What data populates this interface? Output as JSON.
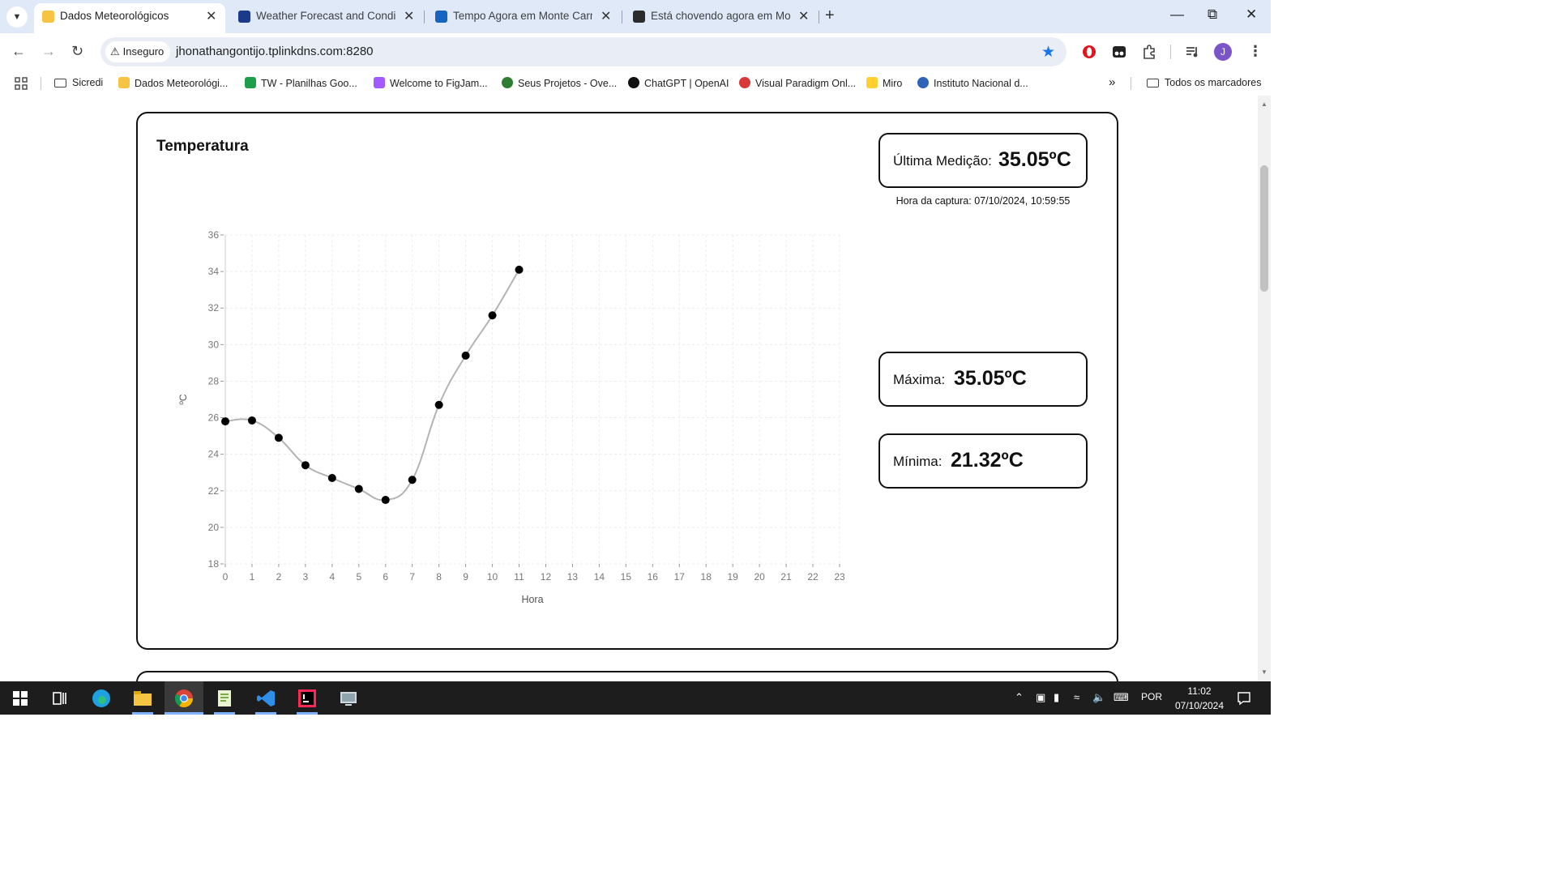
{
  "browser": {
    "tabs": [
      {
        "title": "Dados Meteorológicos",
        "active": true
      },
      {
        "title": "Weather Forecast and Condition",
        "active": false
      },
      {
        "title": "Tempo Agora em Monte Carme",
        "active": false
      },
      {
        "title": "Está chovendo agora em Monte",
        "active": false
      }
    ],
    "security_label": "Inseguro",
    "url": "jhonathangontijo.tplinkdns.com:8280",
    "avatar_letter": "J",
    "bookmarks": [
      {
        "label": "Sicredi"
      },
      {
        "label": "Dados Meteorológi..."
      },
      {
        "label": "TW - Planilhas Goo..."
      },
      {
        "label": "Welcome to FigJam..."
      },
      {
        "label": "Seus Projetos - Ove..."
      },
      {
        "label": "ChatGPT | OpenAI"
      },
      {
        "label": "Visual Paradigm Onl..."
      },
      {
        "label": "Miro"
      },
      {
        "label": "Instituto Nacional d..."
      }
    ],
    "all_bookmarks": "Todos os marcadores"
  },
  "panel": {
    "title": "Temperatura",
    "last": {
      "label": "Última Medição:",
      "value": "35.05ºC"
    },
    "capture_time": "Hora da captura: 07/10/2024, 10:59:55",
    "max": {
      "label": "Máxima:",
      "value": "35.05ºC"
    },
    "min": {
      "label": "Mínima:",
      "value": "21.32ºC"
    }
  },
  "chart_data": {
    "type": "line",
    "xlabel": "Hora",
    "ylabel": "ºC",
    "x": [
      0,
      1,
      2,
      3,
      4,
      5,
      6,
      7,
      8,
      9,
      10,
      11
    ],
    "y": [
      25.8,
      25.85,
      24.9,
      23.4,
      22.7,
      22.1,
      21.5,
      22.6,
      26.7,
      29.4,
      31.6,
      34.1
    ],
    "xlim": [
      0,
      23
    ],
    "ylim": [
      18,
      36
    ],
    "xticks": [
      0,
      1,
      2,
      3,
      4,
      5,
      6,
      7,
      8,
      9,
      10,
      11,
      12,
      13,
      14,
      15,
      16,
      17,
      18,
      19,
      20,
      21,
      22,
      23
    ],
    "yticks": [
      18,
      20,
      22,
      24,
      26,
      28,
      30,
      32,
      34,
      36
    ],
    "line_color": "#b3b3b3",
    "point_color": "#000000",
    "grid": true,
    "smooth": true
  },
  "taskbar": {
    "language": "POR",
    "time": "11:02",
    "date": "07/10/2024"
  }
}
